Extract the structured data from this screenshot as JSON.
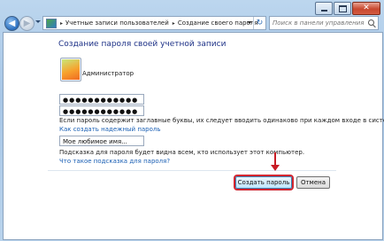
{
  "window": {
    "caption": {
      "minimize_icon": "minimize-icon",
      "maximize_icon": "maximize-icon",
      "close_glyph": "✕"
    }
  },
  "nav": {
    "back_glyph": "◀",
    "forward_glyph": "▶",
    "breadcrumb": [
      "Учетные записи пользователей",
      "Создание своего пароля"
    ],
    "crumb_separator": "▸",
    "refresh_glyph": "↻",
    "search_placeholder": "Поиск в панели управления"
  },
  "page": {
    "title": "Создание пароля своей учетной записи",
    "user": {
      "name": "",
      "role": "Администратор"
    },
    "password_mask": "●●●●●●●●●●●●",
    "confirm_mask": "●●●●●●●●●●●●",
    "case_note": "Если пароль содержит заглавные буквы, их следует вводить одинаково при каждом входе в систему.",
    "strong_link": "Как создать надежный пароль",
    "hint_value": "Мое любимое имя...",
    "hint_note": "Подсказка для пароля будет видна всем, кто использует этот компьютер.",
    "hint_link": "Что такое подсказка для пароля?"
  },
  "buttons": {
    "create": "Создать пароль",
    "cancel": "Отмена"
  },
  "colors": {
    "title": "#1e3287",
    "link": "#1a5fb4",
    "highlight": "#d32630"
  }
}
